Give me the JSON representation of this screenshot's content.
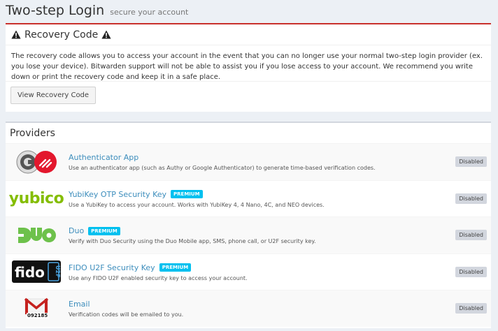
{
  "header": {
    "title": "Two-step Login",
    "subtitle": "secure your account"
  },
  "recovery": {
    "title": "Recovery Code",
    "body": "The recovery code allows you to access your account in the event that you can no longer use your normal two-step login provider (ex. you lose your device). Bitwarden support will not be able to assist you if you lose access to your account. We recommend you write down or print the recovery code and keep it in a safe place.",
    "button_label": "View Recovery Code"
  },
  "providers": {
    "title": "Providers",
    "items": [
      {
        "name": "Authenticator App",
        "premium": "",
        "desc": "Use an authenticator app (such as Authy or Google Authenticator) to generate time-based verification codes.",
        "status": "Disabled",
        "logo": "authenticator-app-logo"
      },
      {
        "name": "YubiKey OTP Security Key",
        "premium": "PREMIUM",
        "desc": "Use a YubiKey to access your account. Works with YubiKey 4, 4 Nano, 4C, and NEO devices.",
        "status": "Disabled",
        "logo": "yubico-logo",
        "logo_text": "yubico"
      },
      {
        "name": "Duo",
        "premium": "PREMIUM",
        "desc": "Verify with Duo Security using the Duo Mobile app, SMS, phone call, or U2F security key.",
        "status": "Disabled",
        "logo": "duo-logo"
      },
      {
        "name": "FIDO U2F Security Key",
        "premium": "PREMIUM",
        "desc": "Use any FIDO U2F enabled security key to access your account.",
        "status": "Disabled",
        "logo": "fido-u2f-logo"
      },
      {
        "name": "Email",
        "premium": "",
        "desc": "Verification codes will be emailed to you.",
        "status": "Disabled",
        "logo": "email-logo",
        "logo_text": "092185"
      }
    ]
  },
  "colors": {
    "danger": "#c9302c",
    "link": "#3c8dbc",
    "premium": "#00c0ef",
    "yubico": "#84bd00",
    "duo": "#6dc14b"
  }
}
